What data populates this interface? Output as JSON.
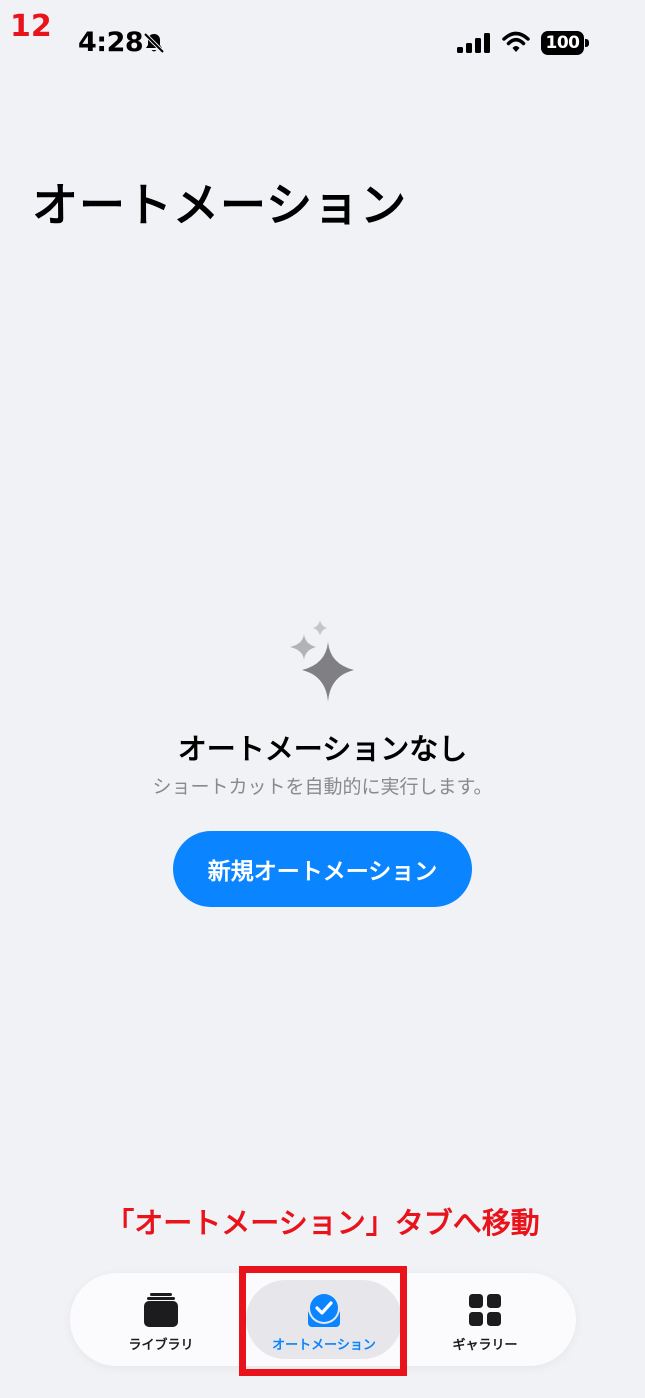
{
  "step_number": "12",
  "status_bar": {
    "time": "4:28",
    "battery": "100"
  },
  "page_title": "オートメーション",
  "empty_state": {
    "icon": "sparkles-icon",
    "title": "オートメーションなし",
    "subtitle": "ショートカットを自動的に実行します。",
    "button_label": "新規オートメーション"
  },
  "annotation": "「オートメーション」タブへ移動",
  "tab_bar": {
    "tabs": [
      {
        "label": "ライブラリ",
        "icon": "library-stack-icon",
        "selected": false
      },
      {
        "label": "オートメーション",
        "icon": "automation-check-icon",
        "selected": true
      },
      {
        "label": "ギャラリー",
        "icon": "gallery-grid-icon",
        "selected": false
      }
    ]
  },
  "colors": {
    "accent": "#0a84ff",
    "annotation": "#e8131b",
    "background": "#f1f2f6"
  }
}
